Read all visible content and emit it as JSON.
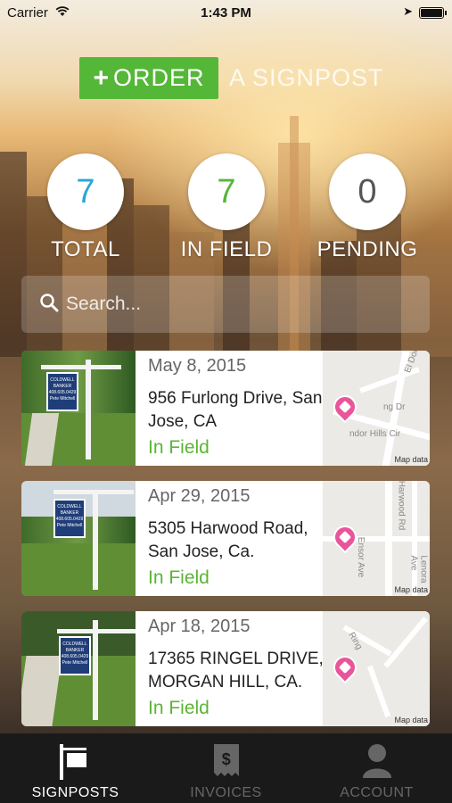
{
  "status_bar": {
    "carrier": "Carrier",
    "time": "1:43 PM"
  },
  "header": {
    "order_plus": "+",
    "order_label": "ORDER",
    "order_suffix": "A SIGNPOST"
  },
  "stats": [
    {
      "value": "7",
      "label": "TOTAL",
      "color": "#2aa6d8"
    },
    {
      "value": "7",
      "label": "IN FIELD",
      "color": "#55b738"
    },
    {
      "value": "0",
      "label": "PENDING",
      "color": "#555555"
    }
  ],
  "search": {
    "placeholder": "Search..."
  },
  "orders": [
    {
      "date": "May 8, 2015",
      "address_line1": "956 Furlong Drive, San",
      "address_line2": "Jose, CA",
      "status": "In Field",
      "map_road1": "El Dor",
      "map_road2": "ng Dr",
      "map_road3": "ndor Hills Cir",
      "map_credit": "Map data"
    },
    {
      "date": "Apr 29, 2015",
      "address_line1": "5305 Harwood Road,",
      "address_line2": "San Jose, Ca.",
      "status": "In Field",
      "map_road1": "Harwood Rd",
      "map_road2": "Ensor Ave",
      "map_road3": "Lenora Ave",
      "map_credit": "Map data"
    },
    {
      "date": "Apr 18, 2015",
      "address_line1": "17365 RINGEL DRIVE,",
      "address_line2": "MORGAN HILL, CA.",
      "status": "In Field",
      "map_road1": "Ring",
      "map_road2": "",
      "map_road3": "",
      "map_credit": "Map data"
    }
  ],
  "sign_text": "COLDWELL BANKER 408.605.0429 Pete Mitchell",
  "tabs": [
    {
      "label": "SIGNPOSTS",
      "icon": "signpost-icon",
      "active": true
    },
    {
      "label": "INVOICES",
      "icon": "invoice-icon",
      "active": false
    },
    {
      "label": "ACCOUNT",
      "icon": "account-icon",
      "active": false
    }
  ],
  "colors": {
    "accent_green": "#55b738",
    "pin_pink": "#e8559a",
    "tabbar_bg": "#1a1a1a"
  }
}
